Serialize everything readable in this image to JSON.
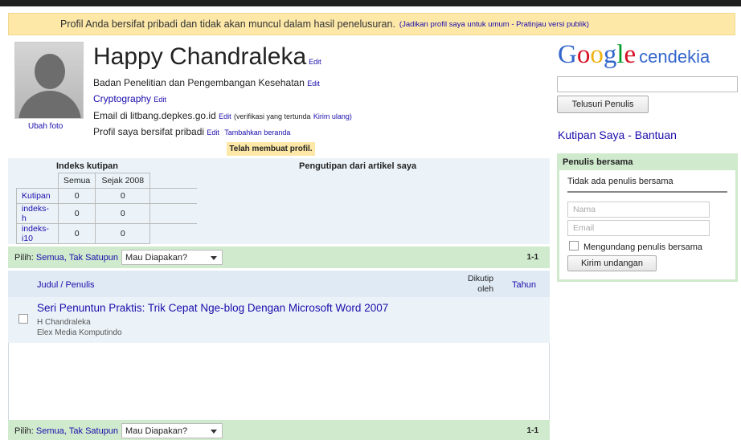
{
  "notice": {
    "text": "Profil Anda bersifat pribadi dan tidak akan muncul dalam hasil penelusuran.",
    "link": "(Jadikan profil saya untuk umum - Pratinjau versi publik)"
  },
  "profile": {
    "change_photo": "Ubah foto",
    "name": "Happy Chandraleka",
    "edit": "Edit",
    "affiliation": "Badan Penelitian dan Pengembangan Kesehatan",
    "interest": "Cryptography",
    "email_text": "Email di litbang.depkes.go.id",
    "verify_text": "(verifikasi yang tertunda",
    "resend": "Kirim ulang)",
    "private_text": "Profil saya bersifat pribadi",
    "add_homepage": "Tambahkan beranda",
    "created": "Telah membuat profil."
  },
  "stats": {
    "title": "Indeks kutipan",
    "citations_title": "Pengutipan dari artikel saya",
    "headers": [
      "Semua",
      "Sejak 2008"
    ],
    "rows": [
      {
        "label": "Kutipan",
        "all": "0",
        "since": "0"
      },
      {
        "label": "indeks-h",
        "all": "0",
        "since": "0"
      },
      {
        "label": "indeks-i10",
        "all": "0",
        "since": "0"
      }
    ]
  },
  "bar": {
    "pilih": "Pilih:",
    "semua": "Semua,",
    "tak_satupun": "Tak Satupun",
    "action": "Mau Diapakan?",
    "pages": "1-1"
  },
  "columns": {
    "title": "Judul / Penulis",
    "cited_1": "Dikutip",
    "cited_2": "oleh",
    "year": "Tahun"
  },
  "articles": [
    {
      "title": "Seri Penuntun Praktis: Trik Cepat Nge-blog Dengan Microsoft Word 2007",
      "authors": "H Chandraleka",
      "publisher": "Elex Media Komputindo"
    }
  ],
  "sidebar": {
    "logo": "Google",
    "logo_sub": "cendekia",
    "search_button": "Telusuri Penulis",
    "kutipan": "Kutipan Saya",
    "separator": " - ",
    "bantuan": "Bantuan",
    "coauthors_title": "Penulis bersama",
    "no_coauthors": "Tidak ada penulis bersama",
    "name_placeholder": "Nama",
    "email_placeholder": "Email",
    "invite_label": "Mengundang penulis bersama",
    "send_button": "Kirim undangan"
  },
  "colors": {
    "notice_bg": "#fde8a8",
    "green_bar": "#cfeacd",
    "blue_bg": "#ebf3f9",
    "link": "#1a0dab"
  }
}
